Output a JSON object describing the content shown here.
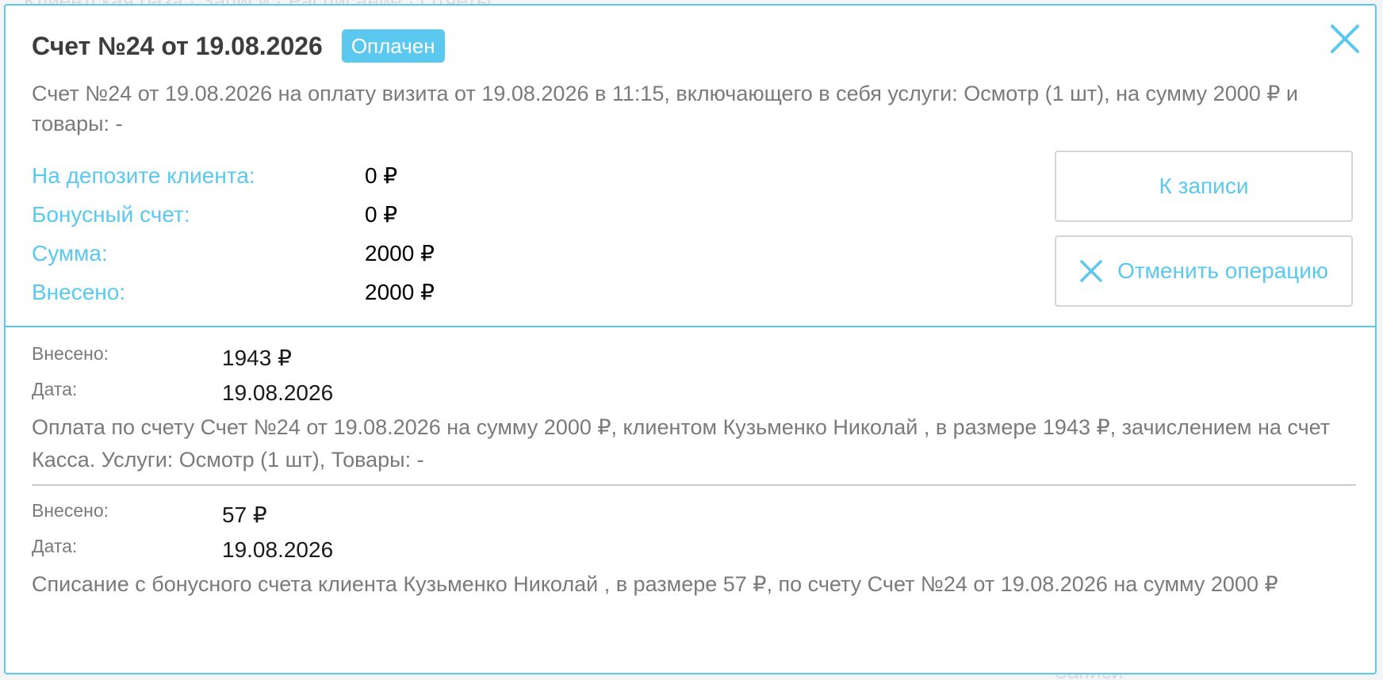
{
  "background": {
    "ghost_text_top": "Клиентская база · Записи · Расписание · Отчеты",
    "ghost_text_bottom": "Записи"
  },
  "modal": {
    "title": "Счет №24 от 19.08.2026",
    "status_badge": "Оплачен",
    "description": "Счет №24 от 19.08.2026 на оплату визита от 19.08.2026 в 11:15, включающего в себя услуги: Осмотр (1 шт), на сумму 2000 ₽ и товары: -",
    "info": [
      {
        "label": "На депозите клиента:",
        "value": "0 ₽"
      },
      {
        "label": "Бонусный счет:",
        "value": "0 ₽"
      },
      {
        "label": "Сумма:",
        "value": "2000 ₽"
      },
      {
        "label": "Внесено:",
        "value": "2000 ₽"
      }
    ],
    "buttons": {
      "to_record": "К записи",
      "cancel_operation": "Отменить операцию"
    },
    "payments": [
      {
        "paid_label": "Внесено:",
        "paid_value": "1943 ₽",
        "date_label": "Дата:",
        "date_value": "19.08.2026",
        "text": "Оплата по счету Счет №24 от 19.08.2026 на сумму 2000 ₽, клиентом Кузьменко Николай , в размере 1943 ₽, зачислением на счет Касса. Услуги: Осмотр (1 шт), Товары: -"
      },
      {
        "paid_label": "Внесено:",
        "paid_value": "57 ₽",
        "date_label": "Дата:",
        "date_value": "19.08.2026",
        "text": "Списание с бонусного счета клиента Кузьменко Николай , в размере 57 ₽, по счету Счет №24 от 19.08.2026 на сумму 2000 ₽"
      }
    ]
  },
  "colors": {
    "accent": "#5ac8ef",
    "text_muted": "#7a7a7a",
    "title": "#3d3d3d"
  },
  "icons": {
    "close": "close-icon",
    "cancel": "x-icon"
  }
}
